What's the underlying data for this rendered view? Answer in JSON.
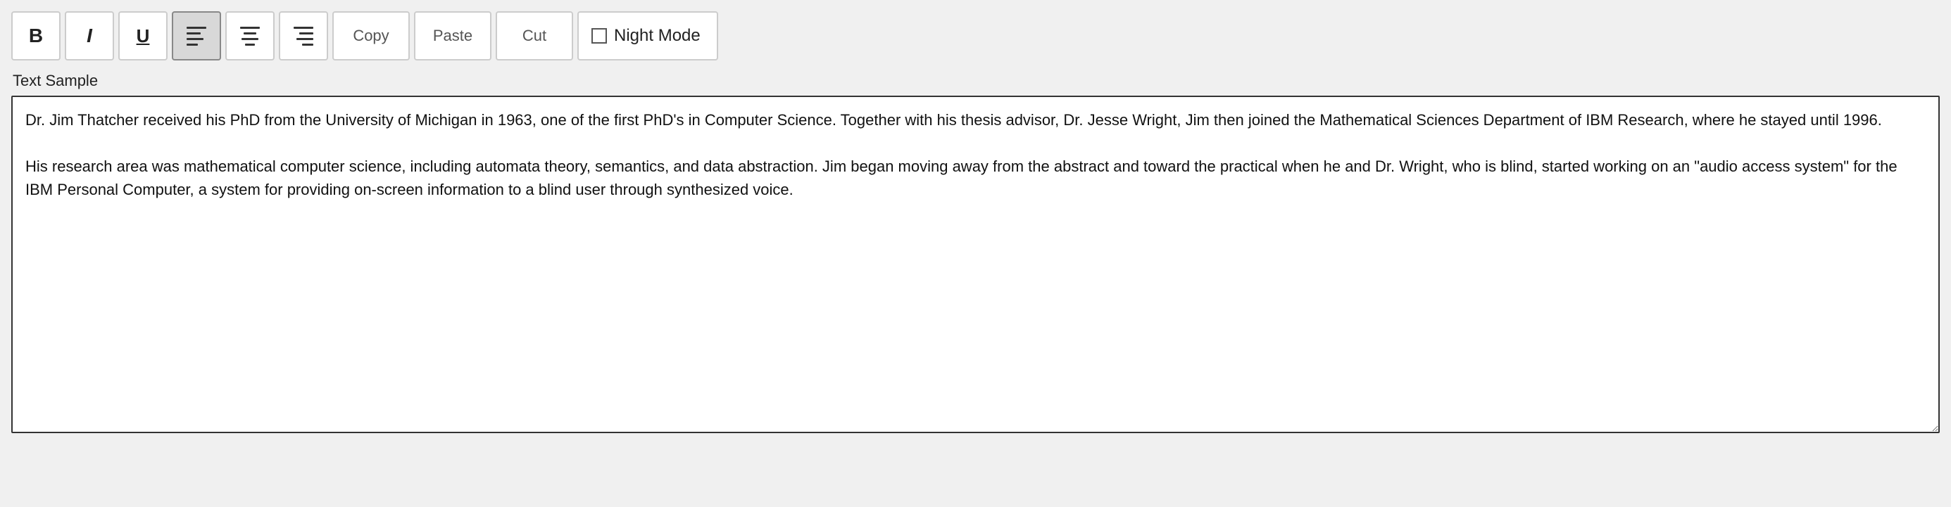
{
  "toolbar": {
    "bold_label": "B",
    "italic_label": "I",
    "underline_label": "U",
    "copy_label": "Copy",
    "paste_label": "Paste",
    "cut_label": "Cut",
    "night_mode_label": "Night Mode"
  },
  "editor": {
    "section_label": "Text Sample",
    "content": "Dr. Jim Thatcher received his PhD from the University of Michigan in 1963, one of the first PhD's in Computer Science. Together with his thesis advisor, Dr. Jesse Wright, Jim then joined the Mathematical Sciences Department of IBM Research, where he stayed until 1996.\n\nHis research area was mathematical computer science, including automata theory, semantics, and data abstraction. Jim began moving away from the abstract and toward the practical when he and Dr. Wright, who is blind, started working on an \"audio access system\" for the IBM Personal Computer, a system for providing on-screen information to a blind user through synthesized voice."
  }
}
